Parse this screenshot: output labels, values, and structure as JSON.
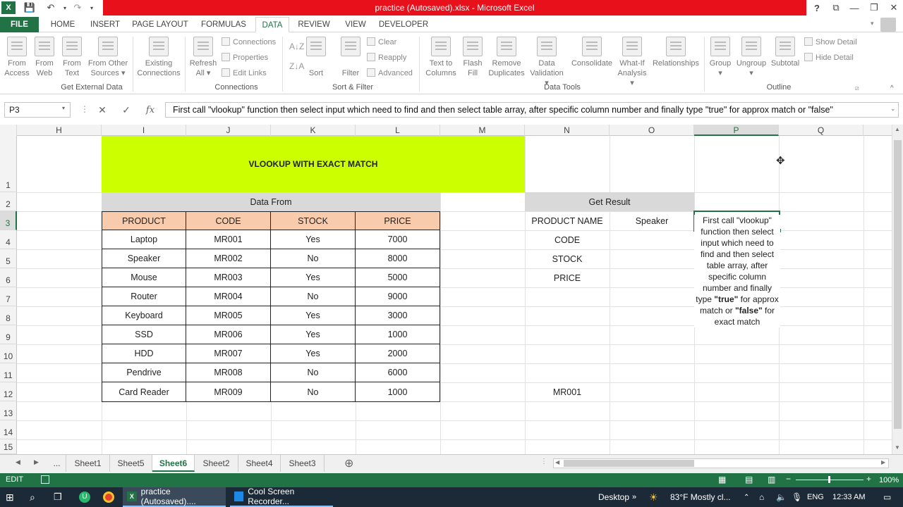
{
  "window": {
    "title": "practice (Autosaved).xlsx - Microsoft Excel",
    "help": "?"
  },
  "tabs": [
    "FILE",
    "HOME",
    "INSERT",
    "PAGE LAYOUT",
    "FORMULAS",
    "DATA",
    "REVIEW",
    "VIEW",
    "DEVELOPER"
  ],
  "ribbon": {
    "get_external": {
      "group": "Get External Data",
      "from_access": [
        "From",
        "Access"
      ],
      "from_web": [
        "From",
        "Web"
      ],
      "from_text": [
        "From",
        "Text"
      ],
      "from_other": [
        "From Other",
        "Sources ▾"
      ],
      "existing": [
        "Existing",
        "Connections"
      ]
    },
    "connections": {
      "group": "Connections",
      "refresh": [
        "Refresh",
        "All ▾"
      ],
      "connections": "Connections",
      "properties": "Properties",
      "edit_links": "Edit Links"
    },
    "sort_filter": {
      "group": "Sort & Filter",
      "sort": "Sort",
      "filter": "Filter",
      "clear": "Clear",
      "reapply": "Reapply",
      "advanced": "Advanced"
    },
    "data_tools": {
      "group": "Data Tools",
      "text_to_columns": [
        "Text to",
        "Columns"
      ],
      "flash_fill": [
        "Flash",
        "Fill"
      ],
      "remove_dup": [
        "Remove",
        "Duplicates"
      ],
      "validation": [
        "Data",
        "Validation ▾"
      ],
      "consolidate": "Consolidate",
      "what_if": [
        "What-If",
        "Analysis ▾"
      ],
      "relationships": "Relationships"
    },
    "outline": {
      "group": "Outline",
      "group_btn": [
        "Group",
        "▾"
      ],
      "ungroup": [
        "Ungroup",
        "▾"
      ],
      "subtotal": "Subtotal",
      "show_detail": "Show Detail",
      "hide_detail": "Hide Detail"
    }
  },
  "formula_bar": {
    "name_box": "P3",
    "fx": "fx",
    "content": "First call \"vlookup\" function then select input which need to find and then select table array, after specific column number and finally type \"true\" for approx match or \"false\""
  },
  "columns": [
    "H",
    "I",
    "J",
    "K",
    "L",
    "M",
    "N",
    "O",
    "P",
    "Q"
  ],
  "rows": [
    "1",
    "2",
    "3",
    "4",
    "5",
    "6",
    "7",
    "8",
    "9",
    "10",
    "11",
    "12",
    "13",
    "14",
    "15"
  ],
  "sheet": {
    "banner": "VLOOKUP WITH EXACT MATCH",
    "data_from": "Data From",
    "get_result": "Get Result",
    "headers": [
      "PRODUCT",
      "CODE",
      "STOCK",
      "PRICE"
    ],
    "table": [
      [
        "Laptop",
        "MR001",
        "Yes",
        "7000"
      ],
      [
        "Speaker",
        "MR002",
        "No",
        "8000"
      ],
      [
        "Mouse",
        "MR003",
        "Yes",
        "5000"
      ],
      [
        "Router",
        "MR004",
        "No",
        "9000"
      ],
      [
        "Keyboard",
        "MR005",
        "Yes",
        "3000"
      ],
      [
        "SSD",
        "MR006",
        "Yes",
        "1000"
      ],
      [
        "HDD",
        "MR007",
        "Yes",
        "2000"
      ],
      [
        "Pendrive",
        "MR008",
        "No",
        "6000"
      ],
      [
        "Card Reader",
        "MR009",
        "No",
        "1000"
      ]
    ],
    "result_labels": [
      "PRODUCT NAME",
      "CODE",
      "STOCK",
      "PRICE"
    ],
    "result_value": "Speaker",
    "n12": "MR001",
    "note": {
      "part1": "First call \"vlookup\" function then select input which need to find and then select table array, after specific column number and finally type ",
      "true": "\"true\"",
      "part2": " for approx match or ",
      "false": "\"false\"",
      "part3": " for exact match"
    }
  },
  "sheet_tabs": {
    "ellipsis": "...",
    "tabs": [
      "Sheet1",
      "Sheet5",
      "Sheet6",
      "Sheet2",
      "Sheet4",
      "Sheet3"
    ],
    "active": "Sheet6",
    "add": "⊕"
  },
  "status": {
    "mode": "EDIT",
    "zoom": "100%"
  },
  "taskbar": {
    "excel": "practice (Autosaved)....",
    "recorder": "Cool Screen Recorder...",
    "desktop": "Desktop",
    "weather": "83°F  Mostly cl...",
    "lang": "ENG",
    "time": "12:33 AM"
  },
  "colors": {
    "excel_green": "#217346",
    "title_red": "#e8101a",
    "banner": "#ccff00",
    "header_fill": "#f8cbad",
    "gray_fill": "#d9d9d9"
  }
}
